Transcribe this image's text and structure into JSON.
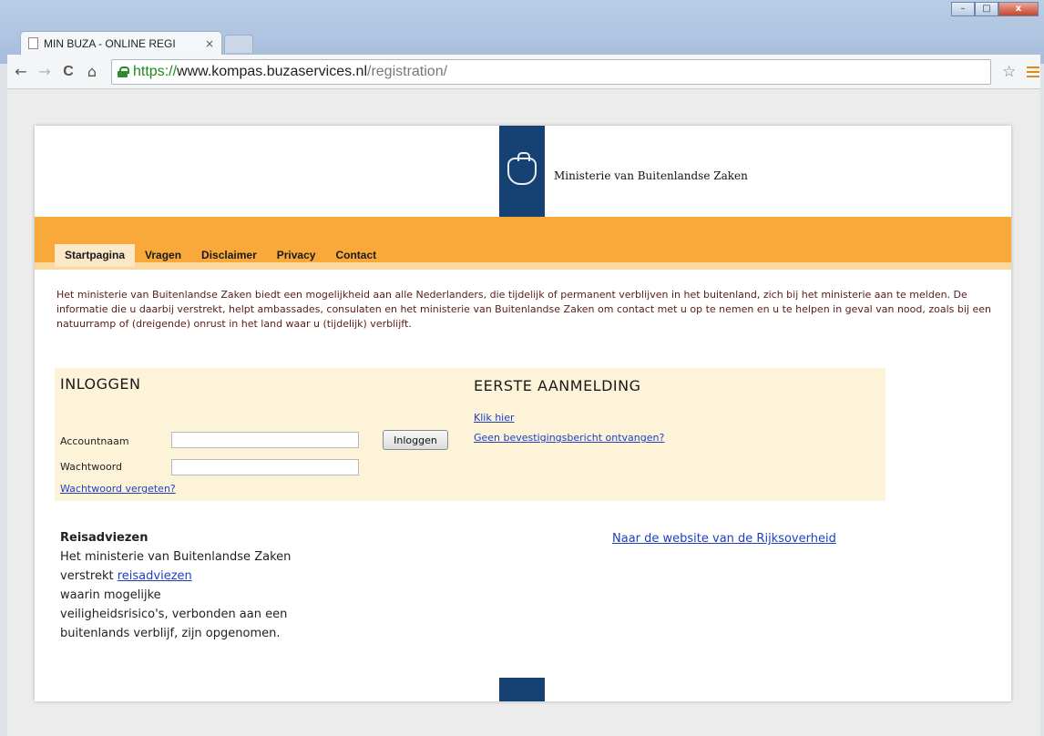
{
  "window": {
    "tab_title": "MIN BUZA - ONLINE REGI",
    "tab_close": "×",
    "controls": {
      "minimize": "–",
      "maximize": "□",
      "close": "x"
    }
  },
  "toolbar": {
    "back_icon": "←",
    "forward_icon": "→",
    "reload_icon": "C",
    "home_icon": "⌂",
    "url_scheme": "https://",
    "url_host": "www.kompas.buzaservices.nl",
    "url_path": "/registration/",
    "bookmark_icon": "☆"
  },
  "header": {
    "ministry_name": "Ministerie van Buitenlandse Zaken"
  },
  "nav": {
    "items": [
      {
        "label": "Startpagina",
        "active": true
      },
      {
        "label": "Vragen",
        "active": false
      },
      {
        "label": "Disclaimer",
        "active": false
      },
      {
        "label": "Privacy",
        "active": false
      },
      {
        "label": "Contact",
        "active": false
      }
    ]
  },
  "intro": {
    "text": "Het ministerie van Buitenlandse Zaken biedt een mogelijkheid aan alle Nederlanders, die tijdelijk of permanent verblijven in het buitenland, zich bij het ministerie aan te melden. De informatie die u daarbij verstrekt, helpt ambassades, consulaten en het ministerie van Buitenlandse Zaken om contact met u op te nemen en u te helpen in geval van nood, zoals bij een natuurramp of (dreigende) onrust in het land waar u (tijdelijk) verblijft."
  },
  "login": {
    "title": "INLOGGEN",
    "account_label": "Accountnaam",
    "account_value": "",
    "password_label": "Wachtwoord",
    "password_value": "",
    "submit_label": "Inloggen",
    "forgot_link": "Wachtwoord vergeten?"
  },
  "first_registration": {
    "title": "EERSTE AANMELDING",
    "click_link": "Klik hier",
    "no_confirmation_link": "Geen bevestigingsbericht ontvangen?"
  },
  "travel_advice": {
    "title": "Reisadviezen",
    "line1": "Het ministerie van Buitenlandse Zaken",
    "line2_prefix": "verstrekt ",
    "line2_link": "reisadviezen",
    "line3": "waarin mogelijke",
    "line4": "veiligheidsrisico's, verbonden aan een",
    "line5": "buitenlands verblijf, zijn opgenomen."
  },
  "rijksoverheid_link": "Naar de website van de Rijksoverheid"
}
